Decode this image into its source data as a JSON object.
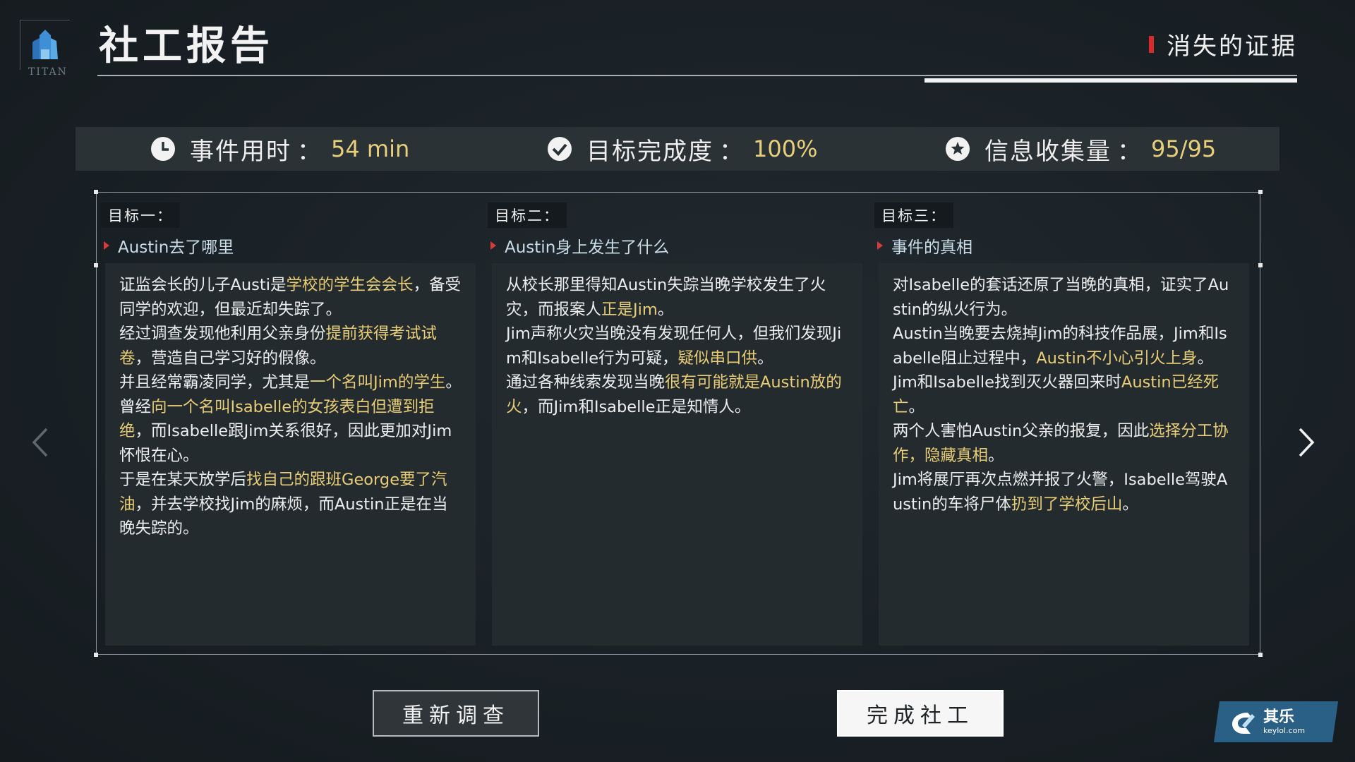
{
  "header": {
    "title": "社工报告",
    "logo_text": "TITAN",
    "chapter": "消失的证据"
  },
  "stats": {
    "time": {
      "label": "事件用时",
      "sep": "：",
      "value": "54 min"
    },
    "completion": {
      "label": "目标完成度",
      "sep": "：",
      "value": "100%"
    },
    "info": {
      "label": "信息收集量",
      "sep": "：",
      "value": "95/95"
    }
  },
  "goals": [
    {
      "title": "目标一：",
      "subtitle": "Austin去了哪里",
      "paragraphs": [
        [
          {
            "t": "证监会长的儿子Austi是"
          },
          {
            "t": "学校的学生会会长",
            "h": true
          },
          {
            "t": "，备受同学的欢迎，但最近却失踪了。"
          }
        ],
        [
          {
            "t": "经过调查发现他利用父亲身份"
          },
          {
            "t": "提前获得考试试卷",
            "h": true
          },
          {
            "t": "，营造自己学习好的假像。"
          }
        ],
        [
          {
            "t": "并且经常霸凌同学，尤其是"
          },
          {
            "t": "一个名叫Jim的学生",
            "h": true
          },
          {
            "t": "。"
          }
        ],
        [
          {
            "t": "曾经"
          },
          {
            "t": "向一个名叫Isabelle的女孩表白但遭到拒绝",
            "h": true
          },
          {
            "t": "，而Isabelle跟Jim关系很好，因此更加对Jim怀恨在心。"
          }
        ],
        [
          {
            "t": "于是在某天放学后"
          },
          {
            "t": "找自己的跟班George要了汽油",
            "h": true
          },
          {
            "t": "，并去学校找Jim的麻烦，而Austin正是在当晚失踪的。"
          }
        ]
      ]
    },
    {
      "title": "目标二：",
      "subtitle": "Austin身上发生了什么",
      "paragraphs": [
        [
          {
            "t": "从校长那里得知Austin失踪当晚学校发生了火灾，而报案人"
          },
          {
            "t": "正是Jim",
            "h": true
          },
          {
            "t": "。"
          }
        ],
        [
          {
            "t": "Jim声称火灾当晚没有发现任何人，但我们发现Jim和Isabelle行为可疑，"
          },
          {
            "t": "疑似串口供",
            "h": true
          },
          {
            "t": "。"
          }
        ],
        [
          {
            "t": "通过各种线索发现当晚"
          },
          {
            "t": "很有可能就是Austin放的火",
            "h": true
          },
          {
            "t": "，而Jim和Isabelle正是知情人。"
          }
        ]
      ]
    },
    {
      "title": "目标三：",
      "subtitle": "事件的真相",
      "paragraphs": [
        [
          {
            "t": "对Isabelle的套话还原了当晚的真相，证实了Austin的纵火行为。"
          }
        ],
        [
          {
            "t": "Austin当晚要去烧掉Jim的科技作品展，Jim和Isabelle阻止过程中，"
          },
          {
            "t": "Austin不小心引火上身",
            "h": true
          },
          {
            "t": "。"
          }
        ],
        [
          {
            "t": "Jim和Isabelle找到灭火器回来时"
          },
          {
            "t": "Austin已经死亡",
            "h": true
          },
          {
            "t": "。"
          }
        ],
        [
          {
            "t": "两个人害怕Austin父亲的报复，因此"
          },
          {
            "t": "选择分工协作，隐藏真相",
            "h": true
          },
          {
            "t": "。"
          }
        ],
        [
          {
            "t": "Jim将展厅再次点燃并报了火警，Isabelle驾驶Austin的车将尸体"
          },
          {
            "t": "扔到了学校后山",
            "h": true
          },
          {
            "t": "。"
          }
        ]
      ]
    }
  ],
  "buttons": {
    "reinvestigate": "重新调查",
    "finish": "完成社工"
  },
  "watermark": {
    "name": "其乐",
    "url": "keylol.com"
  },
  "colors": {
    "highlight": "#e8cd76",
    "accent_red": "#d82a2a"
  }
}
